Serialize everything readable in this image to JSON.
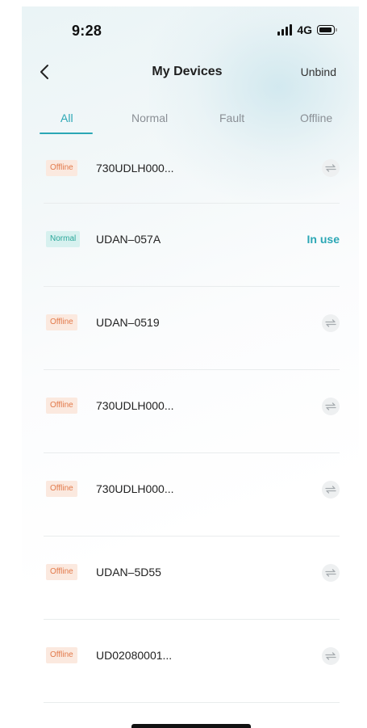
{
  "status_bar": {
    "time": "9:28",
    "network": "4G"
  },
  "header": {
    "title": "My Devices",
    "unbind_label": "Unbind"
  },
  "tabs": [
    {
      "label": "All",
      "active": true
    },
    {
      "label": "Normal",
      "active": false
    },
    {
      "label": "Fault",
      "active": false
    },
    {
      "label": "Offline",
      "active": false
    }
  ],
  "devices": [
    {
      "status": "Offline",
      "name": "730UDLH000...",
      "action": "switch-icon"
    },
    {
      "status": "Normal",
      "name": "UDAN–057A",
      "in_use_label": "In use"
    },
    {
      "status": "Offline",
      "name": "UDAN–0519",
      "action": "switch-icon"
    },
    {
      "status": "Offline",
      "name": "730UDLH000...",
      "action": "switch-icon"
    },
    {
      "status": "Offline",
      "name": "730UDLH000...",
      "action": "switch-icon"
    },
    {
      "status": "Offline",
      "name": "UDAN–5D55",
      "action": "switch-icon"
    },
    {
      "status": "Offline",
      "name": "UD02080001...",
      "action": "switch-icon"
    }
  ],
  "colors": {
    "accent": "#2ba7b5",
    "offline_badge_bg": "#fbe9df",
    "offline_badge_text": "#e27a4b",
    "normal_badge_bg": "#d7f1ef",
    "normal_badge_text": "#2aa79a"
  }
}
